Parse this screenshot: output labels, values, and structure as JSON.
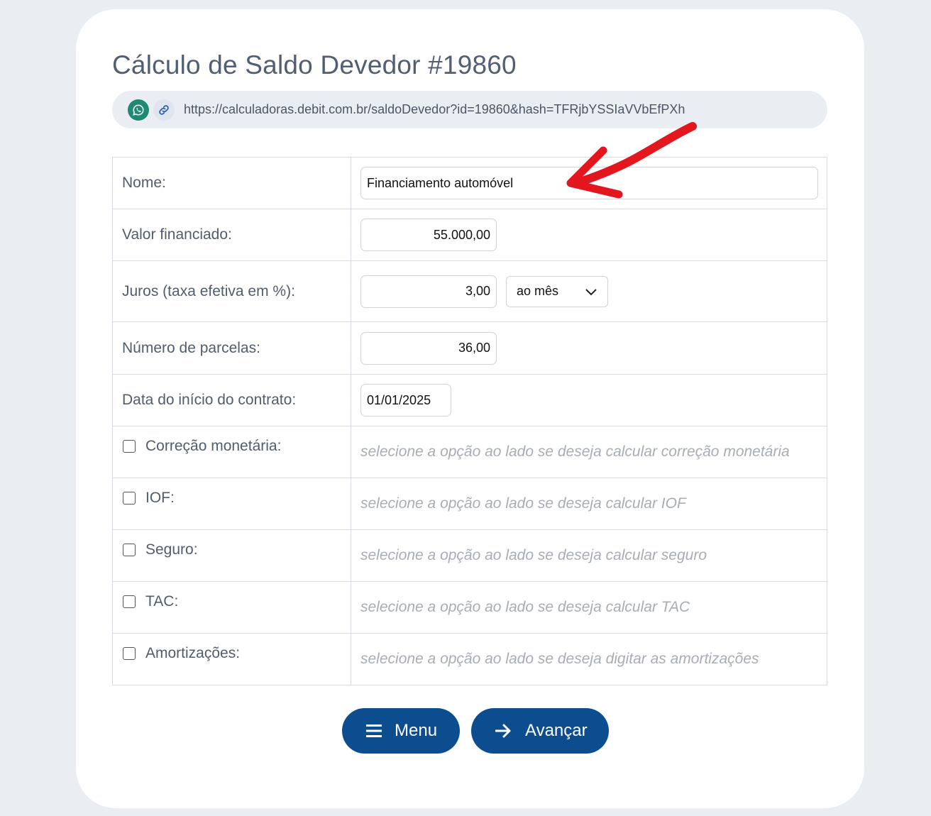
{
  "title": "Cálculo de Saldo Devedor #19860",
  "share": {
    "url": "https://calculadoras.debit.com.br/saldoDevedor?id=19860&hash=TFRjbYSSIaVVbEfPXh",
    "whatsapp_icon": "whatsapp-icon",
    "link_icon": "link-icon"
  },
  "form": {
    "nome": {
      "label": "Nome:",
      "value": "Financiamento automóvel"
    },
    "valor": {
      "label": "Valor financiado:",
      "value": "55.000,00"
    },
    "juros": {
      "label": "Juros (taxa efetiva em %):",
      "value": "3,00",
      "period": "ao mês"
    },
    "parcelas": {
      "label": "Número de parcelas:",
      "value": "36,00"
    },
    "data": {
      "label": "Data do início do contrato:",
      "value": "01/01/2025"
    },
    "options": [
      {
        "label": "Correção monetária:",
        "hint": "selecione a opção ao lado se deseja calcular correção monetária",
        "checked": false
      },
      {
        "label": "IOF:",
        "hint": "selecione a opção ao lado se deseja calcular IOF",
        "checked": false
      },
      {
        "label": "Seguro:",
        "hint": "selecione a opção ao lado se deseja calcular seguro",
        "checked": false
      },
      {
        "label": "TAC:",
        "hint": "selecione a opção ao lado se deseja calcular TAC",
        "checked": false
      },
      {
        "label": "Amortizações:",
        "hint": "selecione a opção ao lado se deseja digitar as amortizações",
        "checked": false
      }
    ]
  },
  "buttons": {
    "menu": {
      "label": "Menu",
      "icon": "hamburger-icon"
    },
    "next": {
      "label": "Avançar",
      "icon": "arrow-right-icon"
    }
  },
  "colors": {
    "page_bg": "#eaeef3",
    "button_bg": "#0b4d8f",
    "whatsapp": "#1f8a74",
    "annotation": "#e3161e"
  }
}
